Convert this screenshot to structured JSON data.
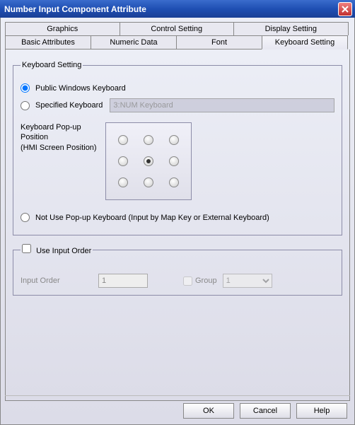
{
  "window": {
    "title": "Number Input Component Attribute"
  },
  "tabs": {
    "row1": [
      "Graphics",
      "Control Setting",
      "Display Setting"
    ],
    "row2": [
      "Basic Attributes",
      "Numeric Data",
      "Font",
      "Keyboard Setting"
    ],
    "active": "Keyboard Setting"
  },
  "keyboard": {
    "legend": "Keyboard Setting",
    "opt_public": "Public Windows Keyboard",
    "opt_specified": "Specified Keyboard",
    "specified_value": "3:NUM Keyboard",
    "popup_label": "Keyboard Pop-up Position\n(HMI Screen Position)",
    "popup_selected": 4,
    "opt_notuse": "Not Use Pop-up Keyboard (Input by Map Key or External Keyboard)",
    "selected": "public"
  },
  "order": {
    "legend": "Use Input Order",
    "checked": false,
    "input_label": "Input Order",
    "input_value": "1",
    "group_label": "Group",
    "group_value": "1"
  },
  "buttons": {
    "ok": "OK",
    "cancel": "Cancel",
    "help": "Help"
  }
}
